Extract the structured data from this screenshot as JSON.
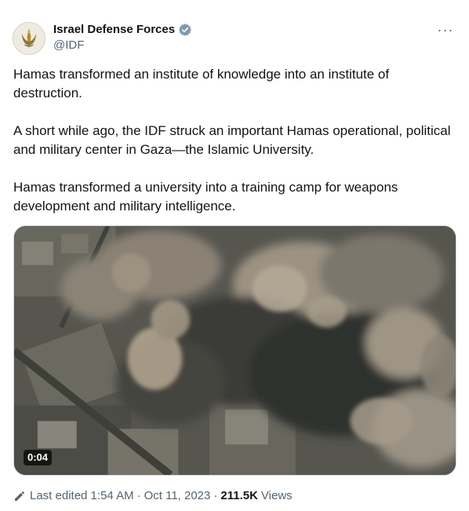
{
  "author": {
    "display_name": "Israel Defense Forces",
    "handle": "@IDF"
  },
  "icons": {
    "avatar": "idf-emblem-icon",
    "verified": "verified-badge-icon",
    "more": "more-icon",
    "edit": "pencil-icon"
  },
  "tweet": {
    "paragraphs": [
      "Hamas transformed an institute of knowledge into an institute of destruction.",
      "A short while ago, the IDF struck an important Hamas operational, political and military center in Gaza—the Islamic University.",
      "Hamas transformed a university into a training camp for weapons development and military intelligence."
    ]
  },
  "media": {
    "duration": "0:04"
  },
  "meta": {
    "edited_label": "Last edited 1:54 AM",
    "separator": "·",
    "date": "Oct 11, 2023",
    "views_count": "211.5K",
    "views_label": "Views"
  },
  "colors": {
    "text": "#0f1419",
    "secondary": "#536471",
    "verified": "#829aab",
    "border": "#cfd9de"
  }
}
